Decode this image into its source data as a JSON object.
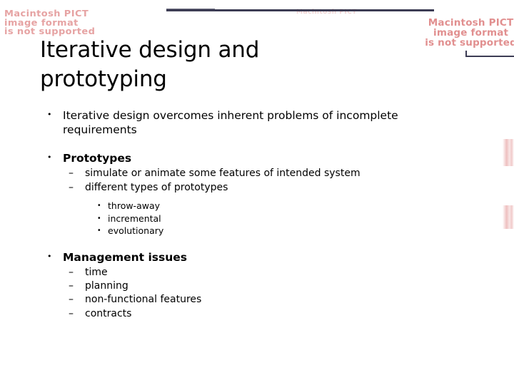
{
  "slide": {
    "title": "Iterative design and prototyping",
    "body": [
      {
        "level": 1,
        "bold": false,
        "marker": "•",
        "text": "Iterative design overcomes inherent problems of incomplete requirements"
      },
      {
        "level": 1,
        "bold": true,
        "marker": "•",
        "text": "Prototypes"
      },
      {
        "level": 2,
        "bold": false,
        "marker": "–",
        "text": "simulate or animate some features of intended system"
      },
      {
        "level": 2,
        "bold": false,
        "marker": "–",
        "text": "different types of prototypes"
      },
      {
        "level": 3,
        "bold": false,
        "marker": "•",
        "text": "throw-away"
      },
      {
        "level": 3,
        "bold": false,
        "marker": "•",
        "text": "incremental"
      },
      {
        "level": 3,
        "bold": false,
        "marker": "•",
        "text": "evolutionary"
      },
      {
        "level": 1,
        "bold": true,
        "marker": "•",
        "text": "Management issues"
      },
      {
        "level": 2,
        "bold": false,
        "marker": "–",
        "text": "time"
      },
      {
        "level": 2,
        "bold": false,
        "marker": "–",
        "text": "planning"
      },
      {
        "level": 2,
        "bold": false,
        "marker": "–",
        "text": "non-functional features"
      },
      {
        "level": 2,
        "bold": false,
        "marker": "–",
        "text": "contracts"
      }
    ]
  },
  "placeholders": {
    "pict_left": {
      "line1": "Macintosh PICT",
      "line2": "image format",
      "line3": "is not supported"
    },
    "pict_right": {
      "line1": "Macintosh PICT",
      "line2": "image format",
      "line3": "is not supported"
    },
    "pict_center": {
      "line1": "Macintosh PICT"
    }
  },
  "colors": {
    "placeholder_text": "#e08a8a",
    "rule_navy": "#3c3c54",
    "body_text": "#000000",
    "background": "#ffffff"
  }
}
